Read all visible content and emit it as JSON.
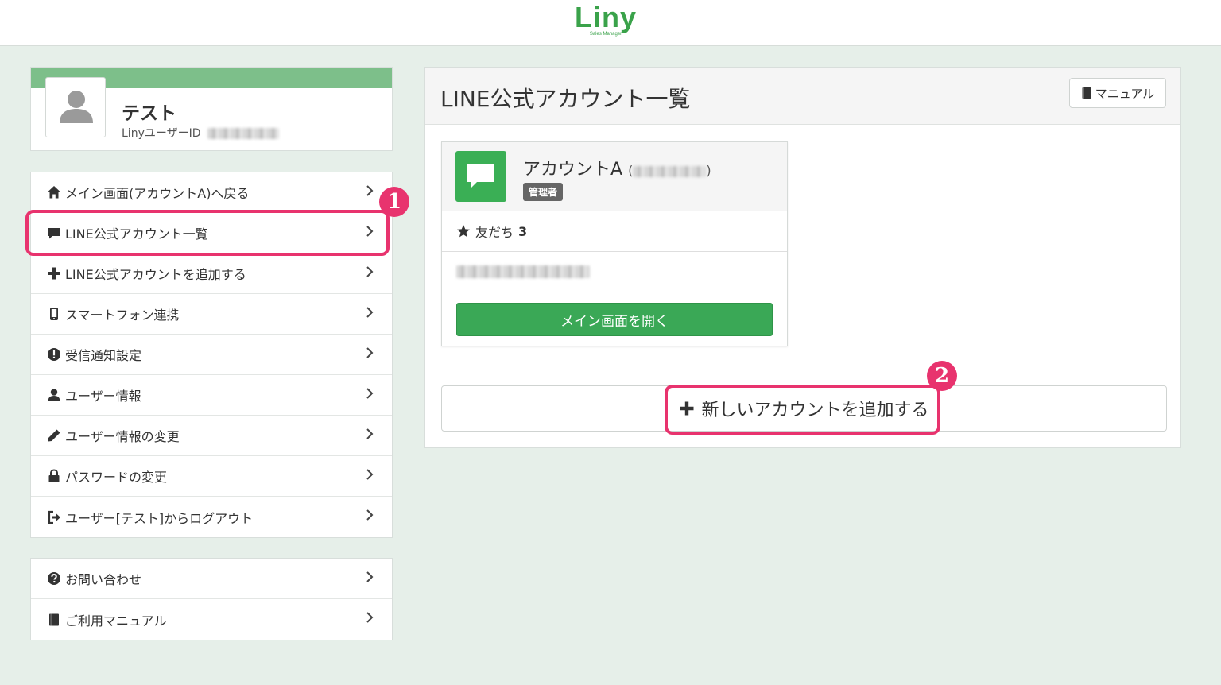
{
  "header": {
    "logo_text": "Liny",
    "logo_subtext": "Sales Manager"
  },
  "profile": {
    "name": "テスト",
    "id_label": "LinyユーザーID"
  },
  "menu_main": [
    {
      "label": "メイン画面(アカウントA)へ戻る",
      "icon": "home-icon"
    },
    {
      "label": "LINE公式アカウント一覧",
      "icon": "chat-icon"
    },
    {
      "label": "LINE公式アカウントを追加する",
      "icon": "plus-icon"
    },
    {
      "label": "スマートフォン連携",
      "icon": "smartphone-icon"
    },
    {
      "label": "受信通知設定",
      "icon": "exclamation-circle-icon"
    },
    {
      "label": "ユーザー情報",
      "icon": "user-icon"
    },
    {
      "label": "ユーザー情報の変更",
      "icon": "pencil-icon"
    },
    {
      "label": "パスワードの変更",
      "icon": "lock-icon"
    },
    {
      "label": "ユーザー[テスト]からログアウト",
      "icon": "logout-icon"
    }
  ],
  "menu_support": [
    {
      "label": "お問い合わせ",
      "icon": "question-circle-icon"
    },
    {
      "label": "ご利用マニュアル",
      "icon": "book-icon"
    }
  ],
  "annotations": {
    "badge1": "1",
    "badge2": "2"
  },
  "panel": {
    "title": "LINE公式アカウント一覧",
    "manual_label": "マニュアル",
    "account": {
      "name": "アカウントA",
      "role": "管理者",
      "friends_label": "友だち",
      "friends_count": "3",
      "open_label": "メイン画面を開く"
    },
    "add_label": "新しいアカウントを追加する"
  },
  "colors": {
    "accent_green": "#3aa856",
    "highlight_pink": "#e8336e",
    "background": "#e6efe9"
  }
}
